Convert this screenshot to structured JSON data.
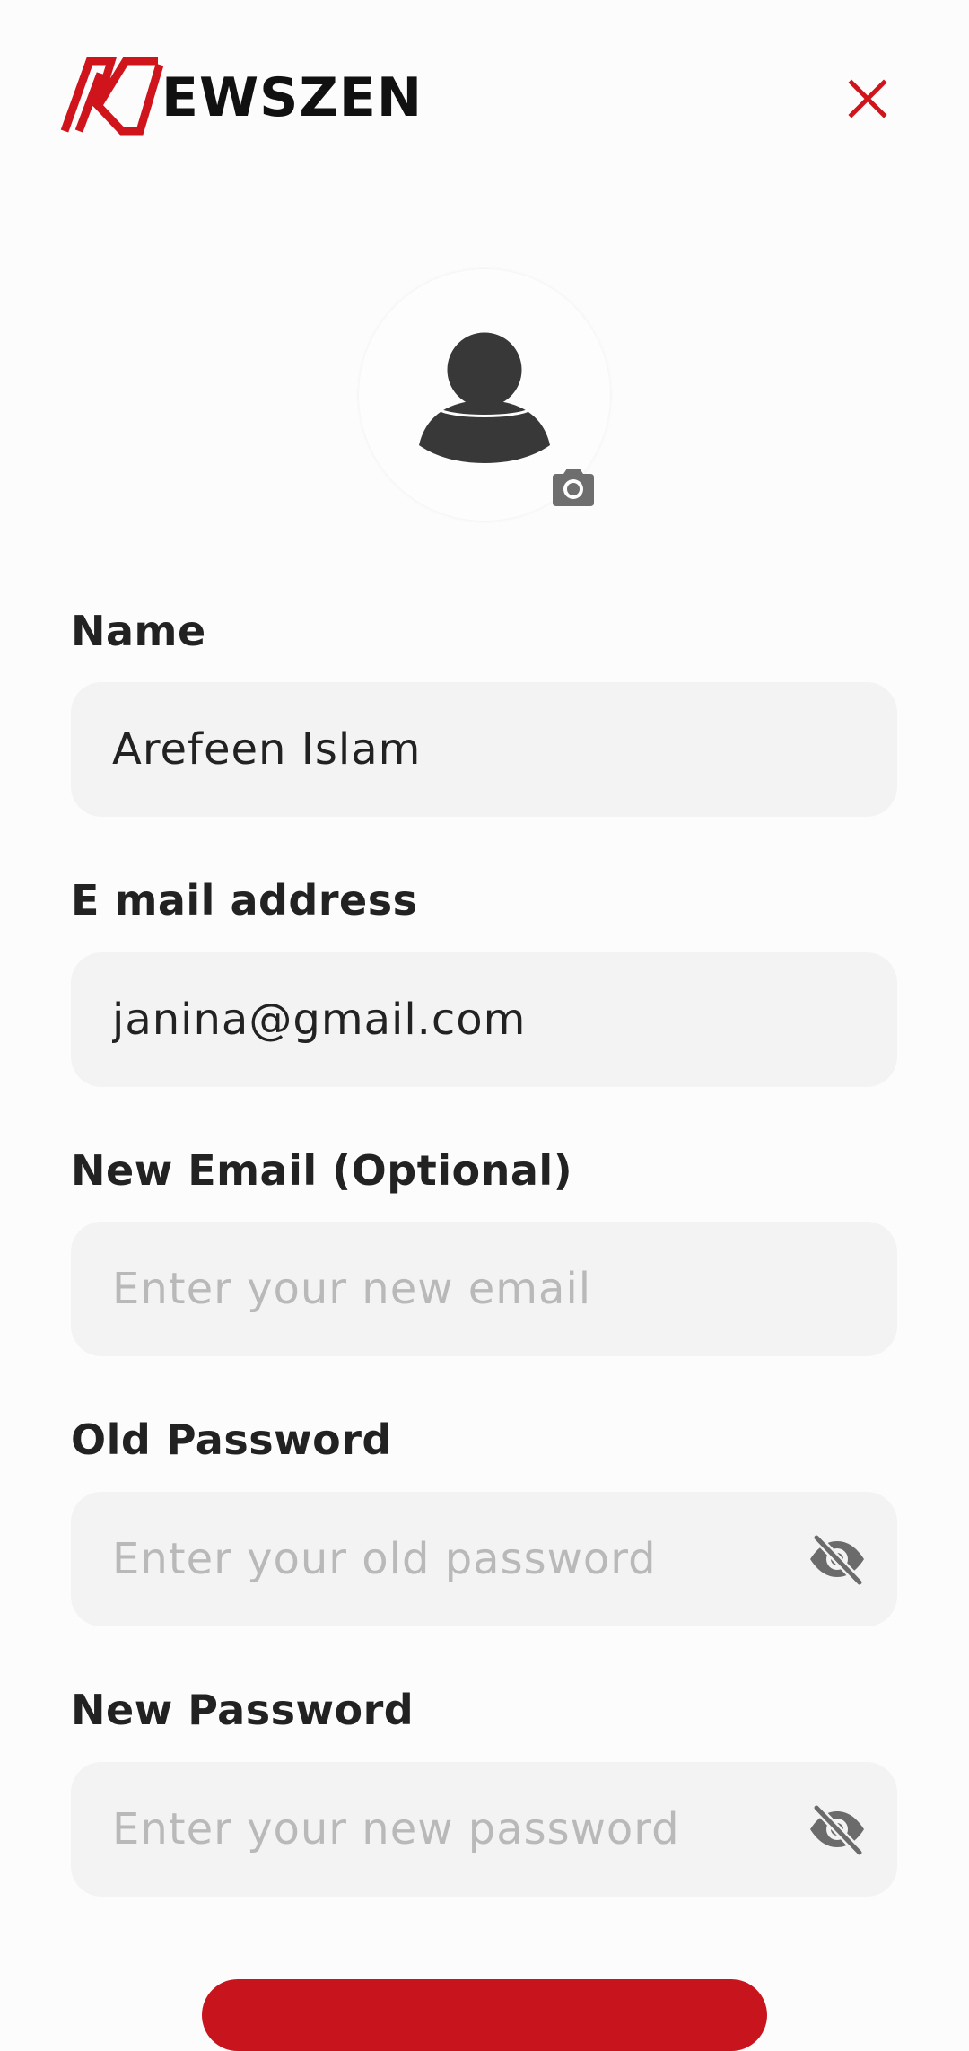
{
  "app": {
    "logo_text": "EWSZEN",
    "brand_color": "#d0141c"
  },
  "header": {
    "close_icon": "close-icon"
  },
  "avatar": {
    "icon": "person-icon",
    "camera_icon": "camera-icon"
  },
  "form": {
    "name": {
      "label": "Name",
      "value": "Arefeen Islam"
    },
    "email": {
      "label": "E mail address",
      "value": "janina@gmail.com"
    },
    "new_email": {
      "label": "New Email (Optional)",
      "placeholder": "Enter your new email"
    },
    "old_password": {
      "label": "Old Password",
      "placeholder": "Enter your old password",
      "toggle_icon": "eye-off-icon"
    },
    "new_password": {
      "label": "New Password",
      "placeholder": "Enter your new password",
      "toggle_icon": "eye-off-icon"
    }
  }
}
